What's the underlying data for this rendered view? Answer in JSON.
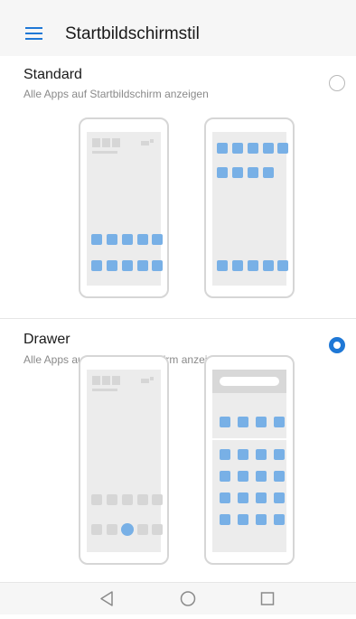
{
  "header": {
    "title": "Startbildschirmstil",
    "menu_icon": "hamburger-menu-icon"
  },
  "options": [
    {
      "title": "Standard",
      "subtitle": "Alle Apps auf Startbildschirm anzeigen",
      "selected": false
    },
    {
      "title": "Drawer",
      "subtitle": "Alle Apps auf Drawer-Bildschirm anzeigen",
      "selected": true
    }
  ],
  "navigation": {
    "buttons": [
      "back-icon",
      "home-icon",
      "recents-icon"
    ]
  },
  "colors": {
    "accent": "#1f78d6",
    "app_tile": "#78b0e6",
    "tile_grey": "#d6d6d6",
    "phone_screen": "#ececec"
  }
}
